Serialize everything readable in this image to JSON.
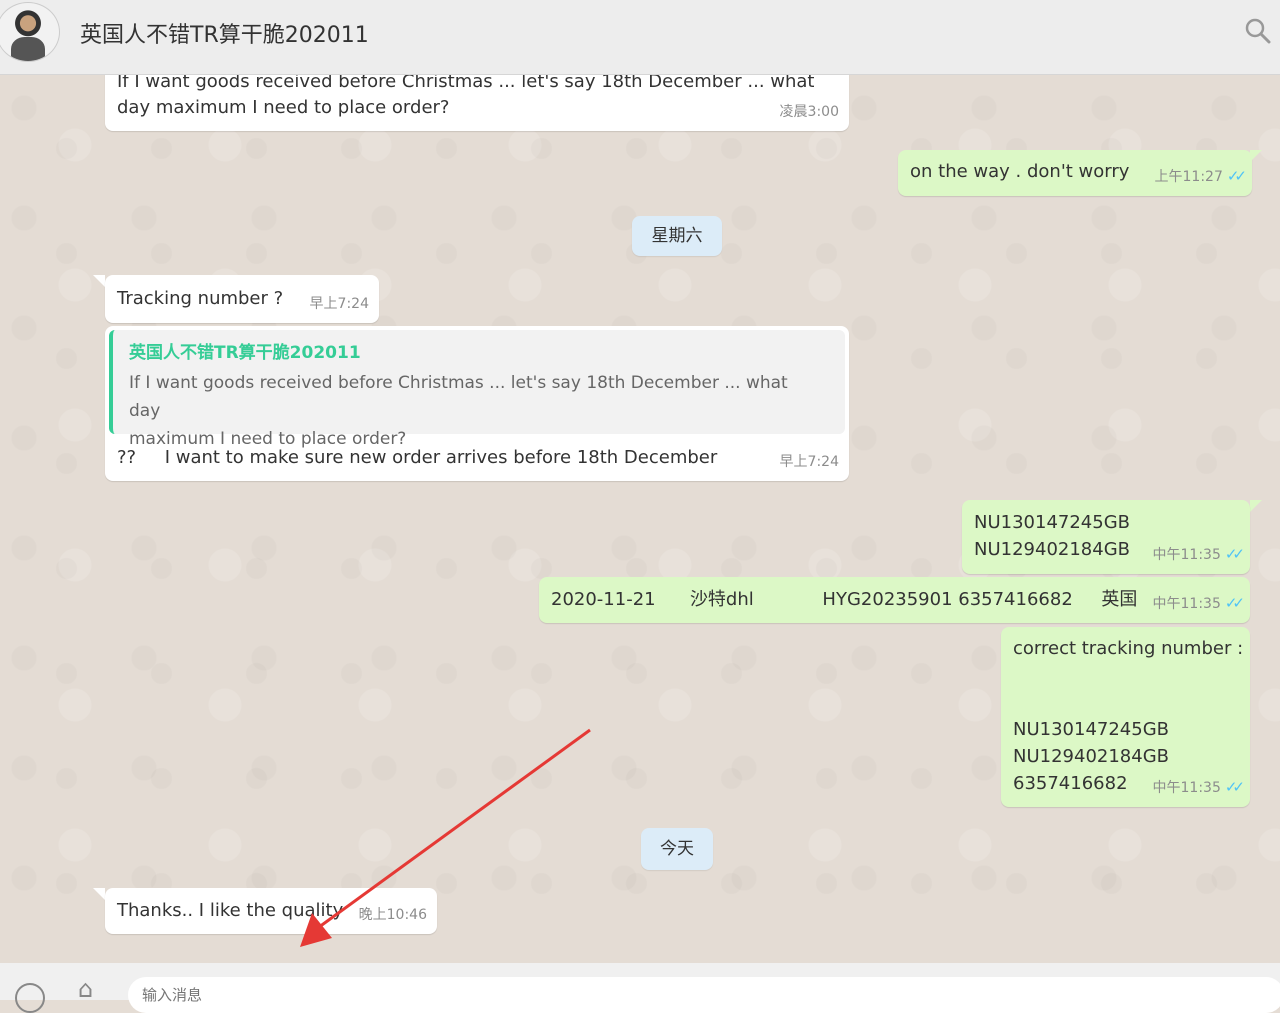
{
  "header": {
    "chat_title": "英国人不错TR算干脆202011"
  },
  "messages": [
    {
      "text_line1": "If I want goods received before Christmas ... let's say 18th December ...   what",
      "text_line2": "day maximum I need to place order?",
      "time": "凌晨3:00"
    },
    {
      "text": "on the way . don't worry",
      "time": "上午11:27"
    },
    {
      "text": "Tracking number ?",
      "time": "早上7:24"
    },
    {
      "quote_author": "英国人不错TR算干脆202011",
      "quote_line1": "If I want goods received before Christmas ... let's say 18th December ...   what day",
      "quote_line2": "maximum I need to place order?",
      "text": "??     I want to make sure new order arrives before 18th December",
      "time": "早上7:24"
    },
    {
      "text_line1": "NU130147245GB",
      "text_line2": "NU129402184GB",
      "time": "中午11:35"
    },
    {
      "text": "2020-11-21      沙特dhl            HYG20235901 6357416682     英国",
      "time": "中午11:35"
    },
    {
      "text_line1": "correct tracking number :",
      "text_line2": "NU130147245GB",
      "text_line3": "NU129402184GB",
      "text_line4": "6357416682",
      "time": "中午11:35"
    },
    {
      "text": "Thanks..  I like the quality",
      "time": "晚上10:46"
    }
  ],
  "dividers": {
    "saturday": "星期六",
    "today": "今天"
  },
  "composer": {
    "placeholder": "输入消息"
  },
  "colors": {
    "incoming": "#ffffff",
    "outgoing": "#dcf8c6",
    "quote_accent": "#35cd96",
    "arrow": "#e53935"
  },
  "icons": [
    "search-icon",
    "read-receipt-icon",
    "emoji-icon",
    "attach-icon"
  ]
}
